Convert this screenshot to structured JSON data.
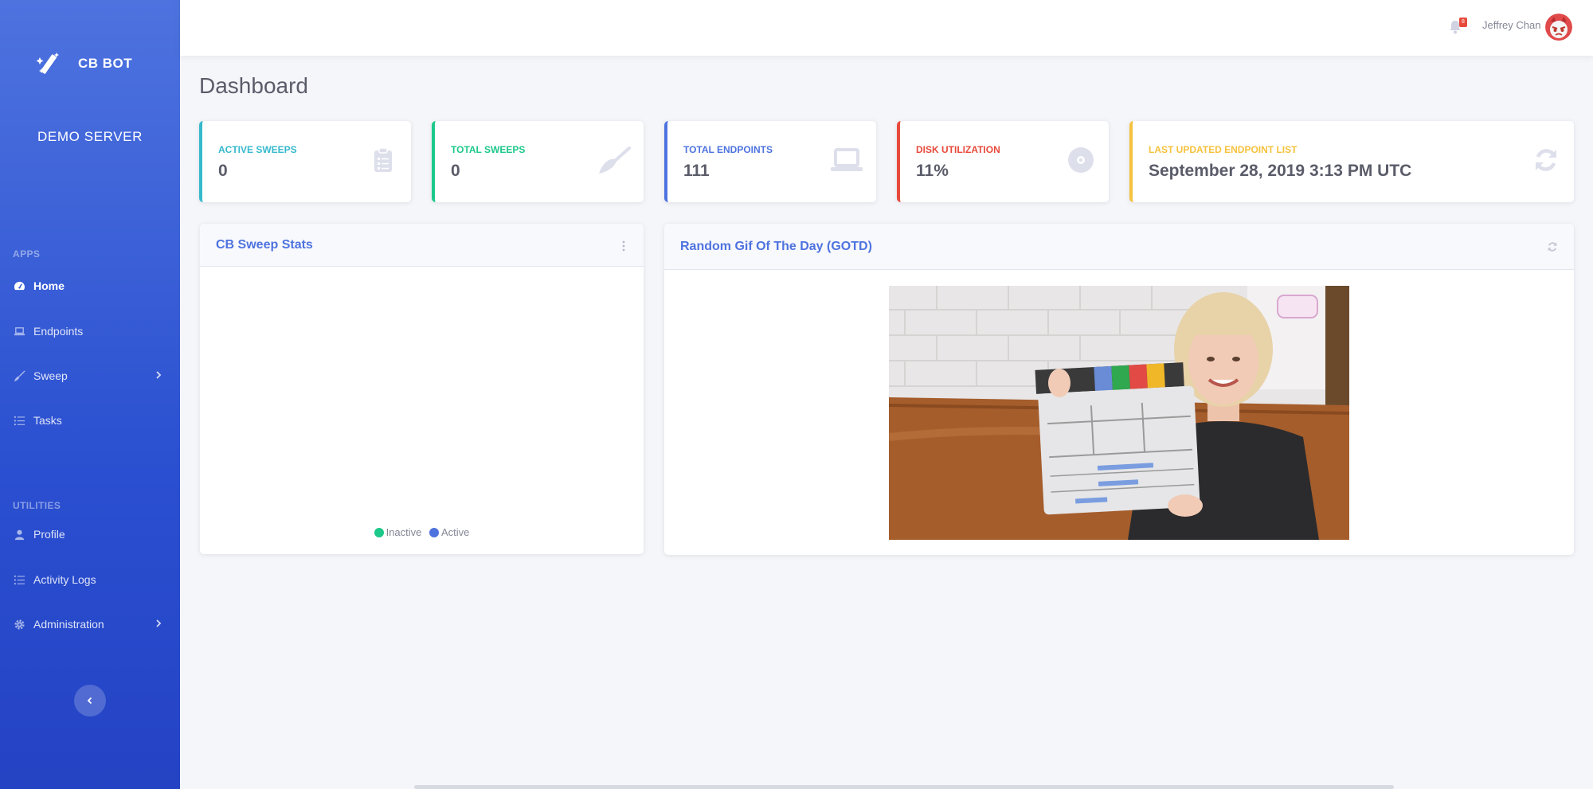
{
  "sidebar": {
    "brand": "CB BOT",
    "server": "DEMO SERVER",
    "sections": {
      "apps": "APPS",
      "utilities": "UTILITIES"
    },
    "items": [
      {
        "label": "Home",
        "icon": "tachometer-icon",
        "active": true
      },
      {
        "label": "Endpoints",
        "icon": "laptop-icon"
      },
      {
        "label": "Sweep",
        "icon": "broom-icon",
        "has_submenu": true
      },
      {
        "label": "Tasks",
        "icon": "tasks-icon"
      },
      {
        "label": "Profile",
        "icon": "user-icon"
      },
      {
        "label": "Activity Logs",
        "icon": "list-icon"
      },
      {
        "label": "Administration",
        "icon": "gear-icon",
        "has_submenu": true
      }
    ]
  },
  "topbar": {
    "notification_count": "8",
    "user_name": "Jeffrey Chan"
  },
  "page": {
    "title": "Dashboard"
  },
  "stats": [
    {
      "label": "ACTIVE SWEEPS",
      "value": "0",
      "color": "#36b9cc",
      "icon": "clipboard-icon"
    },
    {
      "label": "TOTAL SWEEPS",
      "value": "0",
      "color": "#1cc88a",
      "icon": "broom-icon"
    },
    {
      "label": "TOTAL ENDPOINTS",
      "value": "111",
      "color": "#4e73df",
      "icon": "laptop-icon"
    },
    {
      "label": "DISK UTILIZATION",
      "value": "11%",
      "color": "#e74a3b",
      "icon": "disk-icon"
    },
    {
      "label": "LAST UPDATED ENDPOINT LIST",
      "value": "September 28, 2019 3:13 PM UTC",
      "color": "#f6c23e",
      "icon": "refresh-icon"
    }
  ],
  "sweep_stats": {
    "title": "CB Sweep Stats",
    "legend": [
      {
        "label": "Inactive",
        "color": "#1cc88a"
      },
      {
        "label": "Active",
        "color": "#4e73df"
      }
    ]
  },
  "gotd": {
    "title": "Random Gif Of The Day (GOTD)"
  }
}
